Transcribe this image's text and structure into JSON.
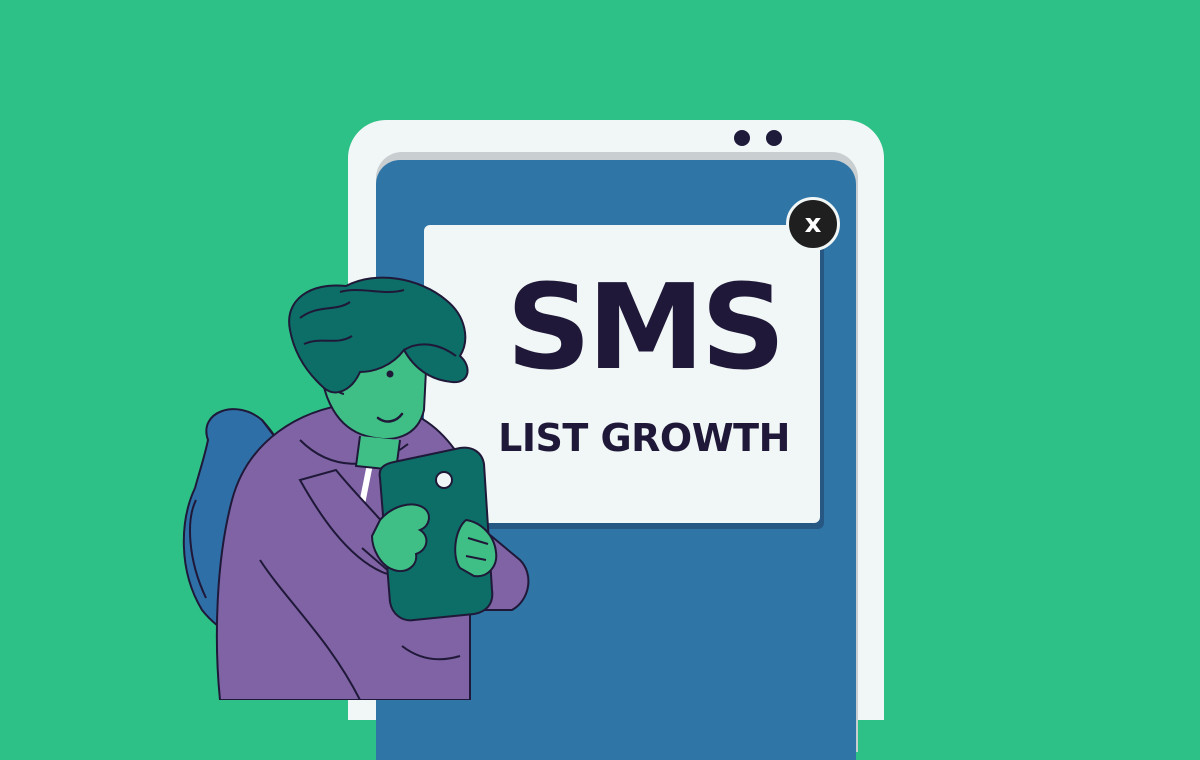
{
  "popup": {
    "headline": "SMS",
    "subheadline": "LIST GROWTH"
  },
  "close_button": {
    "label": "x",
    "icon": "close-icon"
  },
  "colors": {
    "background": "#2ec187",
    "phone_body": "#f1f6f6",
    "phone_screen": "#2f76a7",
    "popup": "#f1f6f6",
    "headline_text": "#1f1838",
    "close_button": "#1f1f1f",
    "hoodie": "#7f63a4",
    "skin": "#3fbf86",
    "hair": "#0c6e66",
    "backpack": "#2f6fa8",
    "phone_held": "#0c6e66"
  }
}
